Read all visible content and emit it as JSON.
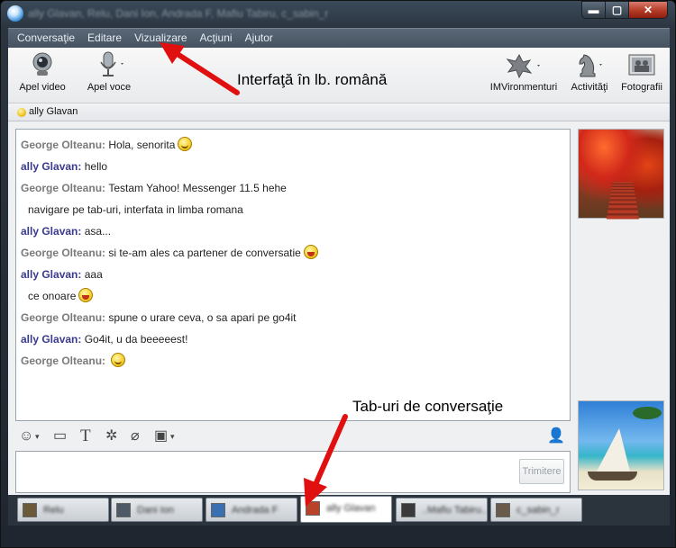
{
  "window": {
    "title": "ally Glavan, Relu, Dani Ion, Andrada F, Mafiu Tabiru, c_sabin_r",
    "controls": {
      "minimize": "▬",
      "maximize": "▢",
      "close": "✕"
    }
  },
  "menu": [
    "Conversaţie",
    "Editare",
    "Vizualizare",
    "Acţiuni",
    "Ajutor"
  ],
  "toolbar": {
    "video_call": "Apel video",
    "voice_call": "Apel voce",
    "imvironments": "IMVironmenturi",
    "activities": "Activităţi",
    "photos": "Fotografii"
  },
  "contact": {
    "name": "ally Glavan"
  },
  "messages": [
    {
      "sender": "George Olteanu",
      "text": "Hola, senorita",
      "emoticon": "smile",
      "kind": "george"
    },
    {
      "sender": "ally Glavan",
      "text": "hello",
      "kind": "ally"
    },
    {
      "sender": "George Olteanu",
      "text": "Testam Yahoo! Messenger 11.5 hehe",
      "kind": "george"
    },
    {
      "sender": "",
      "text": "navigare pe tab-uri, interfata in limba romana",
      "kind": "cont"
    },
    {
      "sender": "ally Glavan",
      "text": "asa...",
      "kind": "ally"
    },
    {
      "sender": "George Olteanu",
      "text": "si te-am ales ca partener de conversatie",
      "emoticon": "laugh",
      "kind": "george"
    },
    {
      "sender": "ally Glavan",
      "text": "aaa",
      "kind": "ally"
    },
    {
      "sender": "",
      "text": "ce onoare",
      "emoticon": "laugh",
      "kind": "cont"
    },
    {
      "sender": "George Olteanu",
      "text": "spune o urare ceva, o sa apari pe go4it",
      "kind": "george"
    },
    {
      "sender": "ally Glavan",
      "text": "Go4it, u da beeeeest!",
      "kind": "ally"
    },
    {
      "sender": "George Olteanu",
      "text": "",
      "emoticon": "wink",
      "kind": "george"
    }
  ],
  "send_button": "Trimitere",
  "tabs": [
    {
      "name": "Relu",
      "color": "#6b5a3a"
    },
    {
      "name": "Dani Ion",
      "color": "#4d5a66"
    },
    {
      "name": "Andrada F",
      "color": "#3a6fb0"
    },
    {
      "name": "ally Glavan",
      "color": "#b8432a"
    },
    {
      "name": "..Mafiu Tabiru..",
      "color": "#3a3a3a"
    },
    {
      "name": "c_sabin_r",
      "color": "#6a5a4a"
    }
  ],
  "annotations": {
    "interface": "Interfaţă în lb. română",
    "tabs": "Tab-uri de conversaţie"
  }
}
